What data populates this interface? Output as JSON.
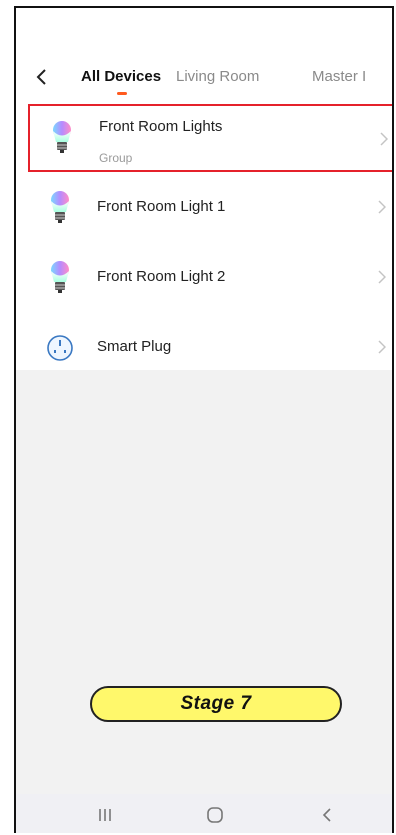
{
  "tabs": {
    "items": [
      {
        "label": "All Devices",
        "active": true
      },
      {
        "label": "Living Room",
        "active": false
      },
      {
        "label": "Master I",
        "active": false
      }
    ]
  },
  "devices": [
    {
      "name": "Front Room Lights",
      "subtitle": "Group",
      "icon": "light-bulb-icon",
      "selected": true
    },
    {
      "name": "Front Room Light 1",
      "icon": "light-bulb-icon"
    },
    {
      "name": "Front Room Light 2",
      "icon": "light-bulb-icon"
    },
    {
      "name": "Smart Plug",
      "icon": "smart-plug-icon"
    }
  ],
  "stage_label": "Stage 7",
  "colors": {
    "accent": "#ff5a1f",
    "selection_border": "#e5212b",
    "stage_label_bg": "#fff86b"
  },
  "navbar": {
    "icons": [
      "recent-apps-icon",
      "home-icon",
      "back-icon"
    ]
  }
}
